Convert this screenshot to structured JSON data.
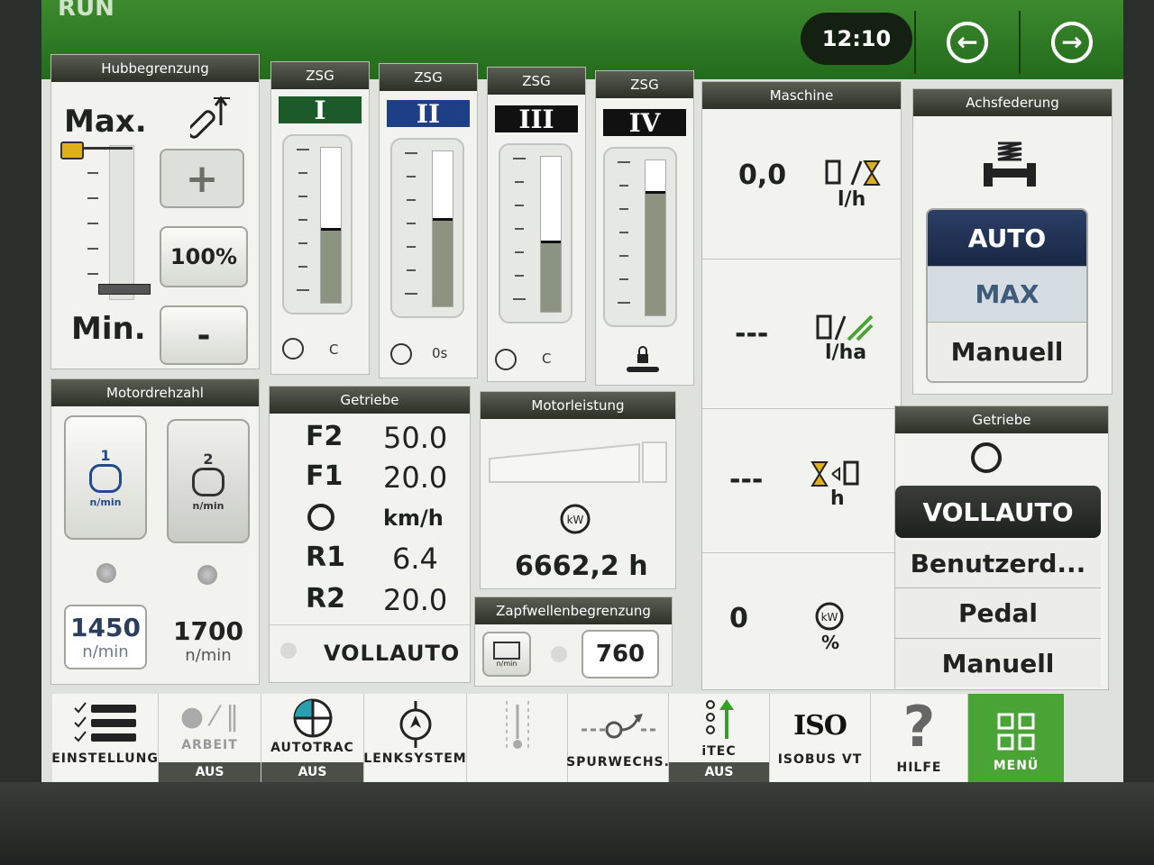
{
  "status": {
    "mode": "RUN",
    "time": "12:10"
  },
  "hubbegrenzung": {
    "title": "Hubbegrenzung",
    "max_label": "Max.",
    "min_label": "Min.",
    "plus": "+",
    "minus": "-",
    "value": "100%"
  },
  "zsg": [
    {
      "title": "ZSG",
      "numeral": "I",
      "header_color": "#1d5a2a",
      "level": 0.48,
      "mode": "C"
    },
    {
      "title": "ZSG",
      "numeral": "II",
      "header_color": "#1e3f86",
      "level": 0.57,
      "mode": "0s"
    },
    {
      "title": "ZSG",
      "numeral": "III",
      "header_color": "#111111",
      "level": 0.46,
      "mode": "C"
    },
    {
      "title": "ZSG",
      "numeral": "IV",
      "header_color": "#111111",
      "level": 0.8,
      "mode": ""
    }
  ],
  "maschine": {
    "title": "Maschine",
    "rows": [
      {
        "value": "0,0",
        "unit": "l/h"
      },
      {
        "value": "---",
        "unit": "l/ha"
      },
      {
        "value": "---",
        "unit": "h"
      },
      {
        "value": "0",
        "unit": "%"
      }
    ]
  },
  "achsfederung": {
    "title": "Achsfederung",
    "options": [
      "AUTO",
      "MAX",
      "Manuell"
    ],
    "selected": "AUTO"
  },
  "motordrehzahl": {
    "title": "Motordrehzahl",
    "unit_icon": "n/min",
    "presets": [
      {
        "index": "1",
        "value": "1450",
        "unit": "n/min"
      },
      {
        "index": "2",
        "value": "1700",
        "unit": "n/min"
      }
    ]
  },
  "getriebe_mid": {
    "title": "Getriebe",
    "rows": [
      {
        "key": "F2",
        "value": "50.0"
      },
      {
        "key": "F1",
        "value": "20.0"
      },
      {
        "key": "",
        "value": "km/h"
      },
      {
        "key": "R1",
        "value": "6.4"
      },
      {
        "key": "R2",
        "value": "20.0"
      }
    ],
    "mode": "VOLLAUTO"
  },
  "motorleistung": {
    "title": "Motorleistung",
    "icon": "kW",
    "hours": "6662,2 h"
  },
  "zapfwelle": {
    "title": "Zapfwellenbegrenzung",
    "value": "760",
    "icon_text": "n/min"
  },
  "getriebe_right": {
    "title": "Getriebe",
    "options": [
      "VOLLAUTO",
      "Benutzerd...",
      "Pedal",
      "Manuell"
    ],
    "selected": "VOLLAUTO"
  },
  "bottom": [
    {
      "label": "EINSTELLUNG",
      "status": ""
    },
    {
      "label": "ARBEIT",
      "status": "AUS"
    },
    {
      "label": "AUTOTRAC",
      "status": "AUS"
    },
    {
      "label": "LENKSYSTEM",
      "status": ""
    },
    {
      "label": "",
      "status": ""
    },
    {
      "label": "SPURWECHS.",
      "status": ""
    },
    {
      "label": "iTEC",
      "status": "AUS"
    },
    {
      "label": "ISOBUS VT",
      "status": ""
    },
    {
      "label": "HILFE",
      "status": ""
    },
    {
      "label": "MENÜ",
      "status": ""
    }
  ],
  "bottom_icons": {
    "isobus": "ISO",
    "hilfe": "?"
  },
  "colors": {
    "accent_green": "#3d8a2e",
    "menu_green": "#4aa335",
    "dark": "#111111"
  }
}
